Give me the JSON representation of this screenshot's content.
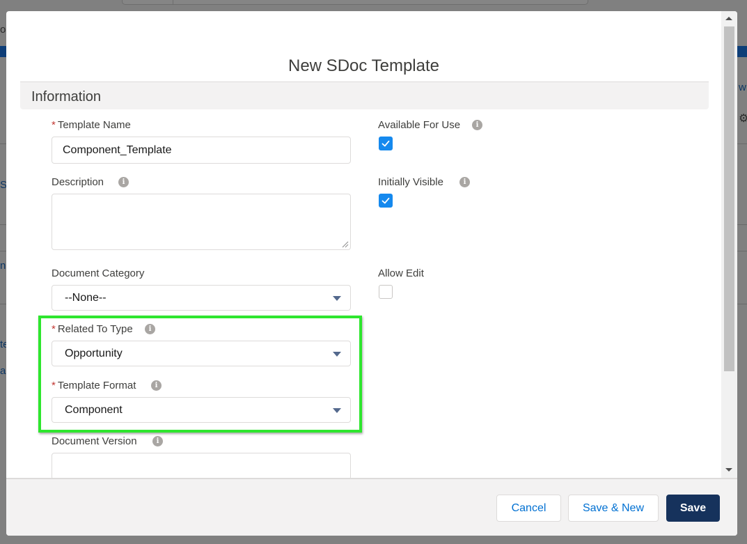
{
  "modal": {
    "title": "New SDoc Template",
    "section_title": "Information"
  },
  "form": {
    "template_name": {
      "label": "Template Name",
      "value": "Component_Template",
      "required": true
    },
    "description": {
      "label": "Description",
      "value": ""
    },
    "document_category": {
      "label": "Document Category",
      "value": "--None--"
    },
    "related_to_type": {
      "label": "Related To Type",
      "value": "Opportunity",
      "required": true
    },
    "template_format": {
      "label": "Template Format",
      "value": "Component",
      "required": true
    },
    "document_version": {
      "label": "Document Version",
      "value": ""
    },
    "available_for_use": {
      "label": "Available For Use",
      "checked": true
    },
    "initially_visible": {
      "label": "Initially Visible",
      "checked": true
    },
    "allow_edit": {
      "label": "Allow Edit",
      "checked": false
    }
  },
  "footer": {
    "cancel_label": "Cancel",
    "save_new_label": "Save & New",
    "save_label": "Save"
  },
  "background": {
    "frag_1": "o",
    "frag_2": "S",
    "frag_3": "na",
    "frag_4": "te",
    "frag_5": "al",
    "frag_6": "w"
  },
  "required_marker": "*",
  "info_glyph": "i",
  "colors": {
    "brand": "#16325c",
    "link": "#0070d2",
    "checkbox": "#1589ee",
    "highlight": "#2ee62e",
    "required": "#c23934"
  }
}
